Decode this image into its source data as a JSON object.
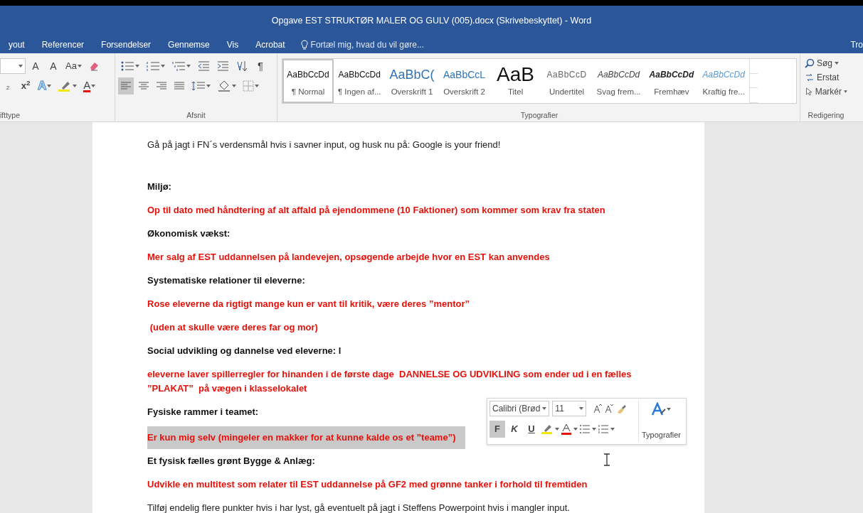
{
  "window": {
    "title": "Opgave EST STRUKTØR MALER OG GULV (005).docx (Skrivebeskyttet) - Word"
  },
  "tabs": [
    {
      "label": "yout",
      "selected": false
    },
    {
      "label": "Referencer",
      "selected": false
    },
    {
      "label": "Forsendelser",
      "selected": false
    },
    {
      "label": "Gennemse",
      "selected": false
    },
    {
      "label": "Vis",
      "selected": false
    },
    {
      "label": "Acrobat",
      "selected": false
    }
  ],
  "tell_me": {
    "placeholder": "Fortæl mig, hvad du vil gøre..."
  },
  "account_cut": "Tro",
  "font_group": {
    "label": "ifttype",
    "row1": [
      {
        "kind": "dropdown"
      },
      {
        "kind": "grow",
        "label": "A"
      },
      {
        "kind": "shrink",
        "label": "A"
      },
      {
        "kind": "case",
        "label": "Aa"
      },
      {
        "kind": "clear"
      }
    ],
    "row2": [
      {
        "kind": "subscript",
        "label": "$_{2}$"
      },
      {
        "kind": "superscript",
        "label": "x$^{2}$"
      },
      {
        "kind": "effect",
        "label": "A"
      },
      {
        "kind": "highlight"
      },
      {
        "kind": "fontcolor",
        "label": "A"
      }
    ]
  },
  "paragraph_group": {
    "label": "Afsnit",
    "row1": [
      {
        "kind": "bullets"
      },
      {
        "kind": "numbering"
      },
      {
        "kind": "multilevel"
      },
      {
        "kind": "outdent"
      },
      {
        "kind": "indent"
      },
      {
        "kind": "sort"
      },
      {
        "kind": "marks",
        "label": "¶"
      }
    ],
    "row2": [
      {
        "kind": "left",
        "selected": true
      },
      {
        "kind": "center",
        "selected": false
      },
      {
        "kind": "right",
        "selected": false
      },
      {
        "kind": "justify",
        "selected": false
      },
      {
        "kind": "spacing",
        "selected": false
      },
      {
        "kind": "shading",
        "selected": false
      },
      {
        "kind": "borders",
        "selected": false
      }
    ]
  },
  "styles_group": {
    "label": "Typografier",
    "styles": [
      {
        "kind": "normal",
        "preview": "AaBbCcDd",
        "label": "¶ Normal",
        "selected": true
      },
      {
        "kind": "nospacing",
        "preview": "AaBbCcDd",
        "label": "¶ Ingen af...",
        "selected": false
      },
      {
        "kind": "heading1",
        "preview": "AaBbC(",
        "label": "Overskrift 1",
        "selected": false
      },
      {
        "kind": "heading2",
        "preview": "AaBbCcL",
        "label": "Overskrift 2",
        "selected": false
      },
      {
        "kind": "title",
        "preview": "AaB",
        "label": "Titel",
        "selected": false
      },
      {
        "kind": "subtitle",
        "preview": "AaBbCcD",
        "label": "Undertitel",
        "selected": false
      },
      {
        "kind": "subtle",
        "preview": "AaBbCcDd",
        "label": "Svag frem...",
        "selected": false
      },
      {
        "kind": "emphasis",
        "preview": "AaBbCcDd",
        "label": "Fremhæv",
        "selected": false
      },
      {
        "kind": "intense",
        "preview": "AaBbCcDd",
        "label": "Kraftig fre...",
        "selected": false
      }
    ]
  },
  "editing_group": {
    "label": "Redigering",
    "items": [
      {
        "kind": "find",
        "label": "Søg"
      },
      {
        "kind": "replace",
        "label": "Erstat"
      },
      {
        "kind": "select",
        "label": "Markér"
      }
    ]
  },
  "document": [
    {
      "kind": "body",
      "text": "Gå på jagt i FN´s verdensmål hvis i savner input, og husk nu på: Google is your friend!",
      "highlighted": false
    },
    {
      "kind": "heading",
      "text": "Miljø:",
      "highlighted": false
    },
    {
      "kind": "red",
      "text": "Op til dato med håndtering af alt affald på ejendommene (10 Faktioner) som kommer som krav fra staten",
      "highlighted": false
    },
    {
      "kind": "heading",
      "text": "Økonomisk vækst:",
      "highlighted": false
    },
    {
      "kind": "red",
      "text": "Mer salg af EST uddannelsen på landevejen, opsøgende arbejde hvor en EST kan anvendes",
      "highlighted": false
    },
    {
      "kind": "heading",
      "text": "Systematiske relationer til eleverne:",
      "highlighted": false
    },
    {
      "kind": "red",
      "text": "Rose eleverne da rigtigt mange kun er vant til kritik, være deres ”mentor”",
      "highlighted": false
    },
    {
      "kind": "red",
      "text": " (uden at skulle være deres far og mor)",
      "highlighted": false
    },
    {
      "kind": "heading",
      "text": "Social udvikling og dannelse ved eleverne: l",
      "highlighted": false
    },
    {
      "kind": "red",
      "text": "eleverne laver spillerregler for hinanden i de første dage  DANNELSE OG UDVIKLING som ender ud i en fælles  ”PLAKAT”  på vægen i klasselokalet",
      "highlighted": false
    },
    {
      "kind": "heading",
      "text": "Fysiske rammer i teamet:",
      "highlighted": false
    },
    {
      "kind": "red",
      "text": "Er kun mig selv (mingeler en makker for at kunne kalde os et ”teame”)",
      "highlighted": true
    },
    {
      "kind": "heading",
      "text": "Et fysisk fælles grønt Bygge & Anlæg:",
      "highlighted": false
    },
    {
      "kind": "red",
      "text": "Udvikle en multitest som relater til EST uddannelse på GF2 med grønne tanker i forhold til fremtiden",
      "highlighted": false
    },
    {
      "kind": "body",
      "text": "Tilføj endelig flere punkter hvis i har lyst, gå eventuelt på jagt i Steffens Powerpoint hvis i mangler input.",
      "highlighted": false
    }
  ],
  "mini_toolbar": {
    "font": "Calibri (Brød",
    "size": "11",
    "styles_label": "Typografier",
    "buttons": [
      {
        "kind": "bold",
        "label": "F",
        "selected": true
      },
      {
        "kind": "italic",
        "label": "K",
        "selected": false
      },
      {
        "kind": "underline",
        "label": "U",
        "selected": false
      }
    ]
  }
}
